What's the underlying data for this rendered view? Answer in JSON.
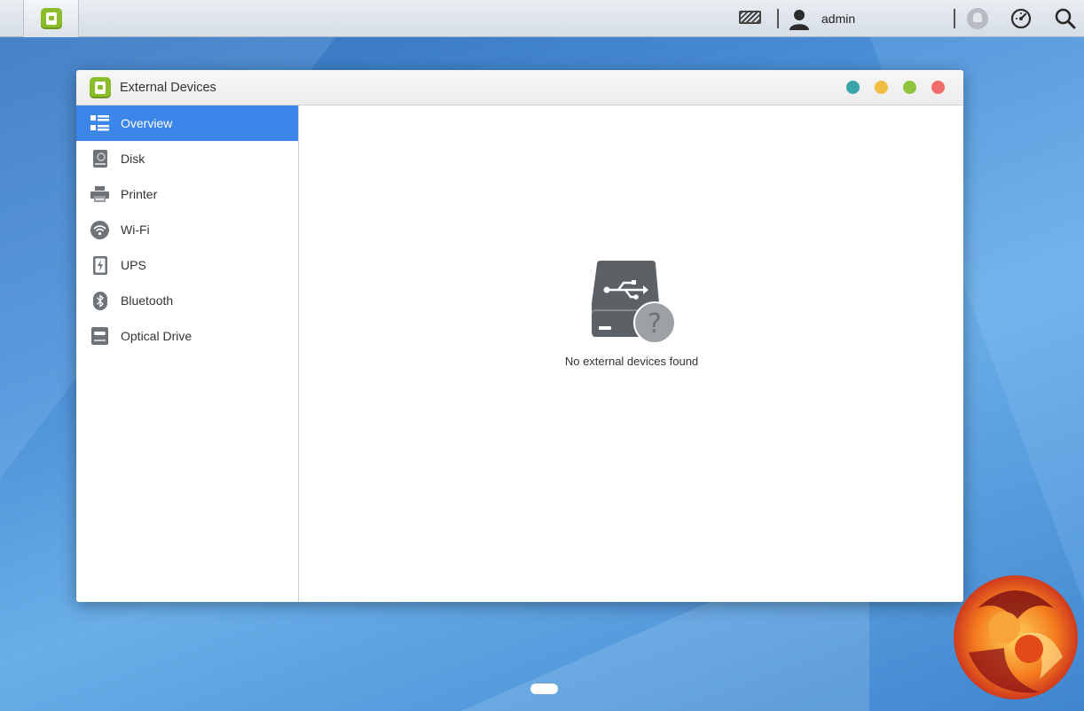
{
  "taskbar": {
    "app_icon": "external-devices-icon",
    "user_label": "admin",
    "icons": [
      "keyboard-icon",
      "user-icon",
      "notification-bell-icon",
      "resource-monitor-icon",
      "search-icon"
    ]
  },
  "window": {
    "title": "External Devices",
    "controls": [
      "teal-button",
      "minimize-button",
      "maximize-button",
      "close-button"
    ],
    "colors": {
      "teal": "#3aa5a8",
      "minimize": "#f1bd43",
      "maximize": "#8dc43c",
      "close": "#f26b6b"
    }
  },
  "sidebar": {
    "items": [
      {
        "label": "Overview",
        "icon": "overview-icon",
        "active": true
      },
      {
        "label": "Disk",
        "icon": "disk-icon",
        "active": false
      },
      {
        "label": "Printer",
        "icon": "printer-icon",
        "active": false
      },
      {
        "label": "Wi-Fi",
        "icon": "wifi-icon",
        "active": false
      },
      {
        "label": "UPS",
        "icon": "ups-icon",
        "active": false
      },
      {
        "label": "Bluetooth",
        "icon": "bluetooth-icon",
        "active": false
      },
      {
        "label": "Optical Drive",
        "icon": "optical-drive-icon",
        "active": false
      }
    ],
    "accent": "#3b86e8"
  },
  "main": {
    "empty_message": "No external devices found",
    "empty_icon": "usb-drive-unknown-icon"
  }
}
